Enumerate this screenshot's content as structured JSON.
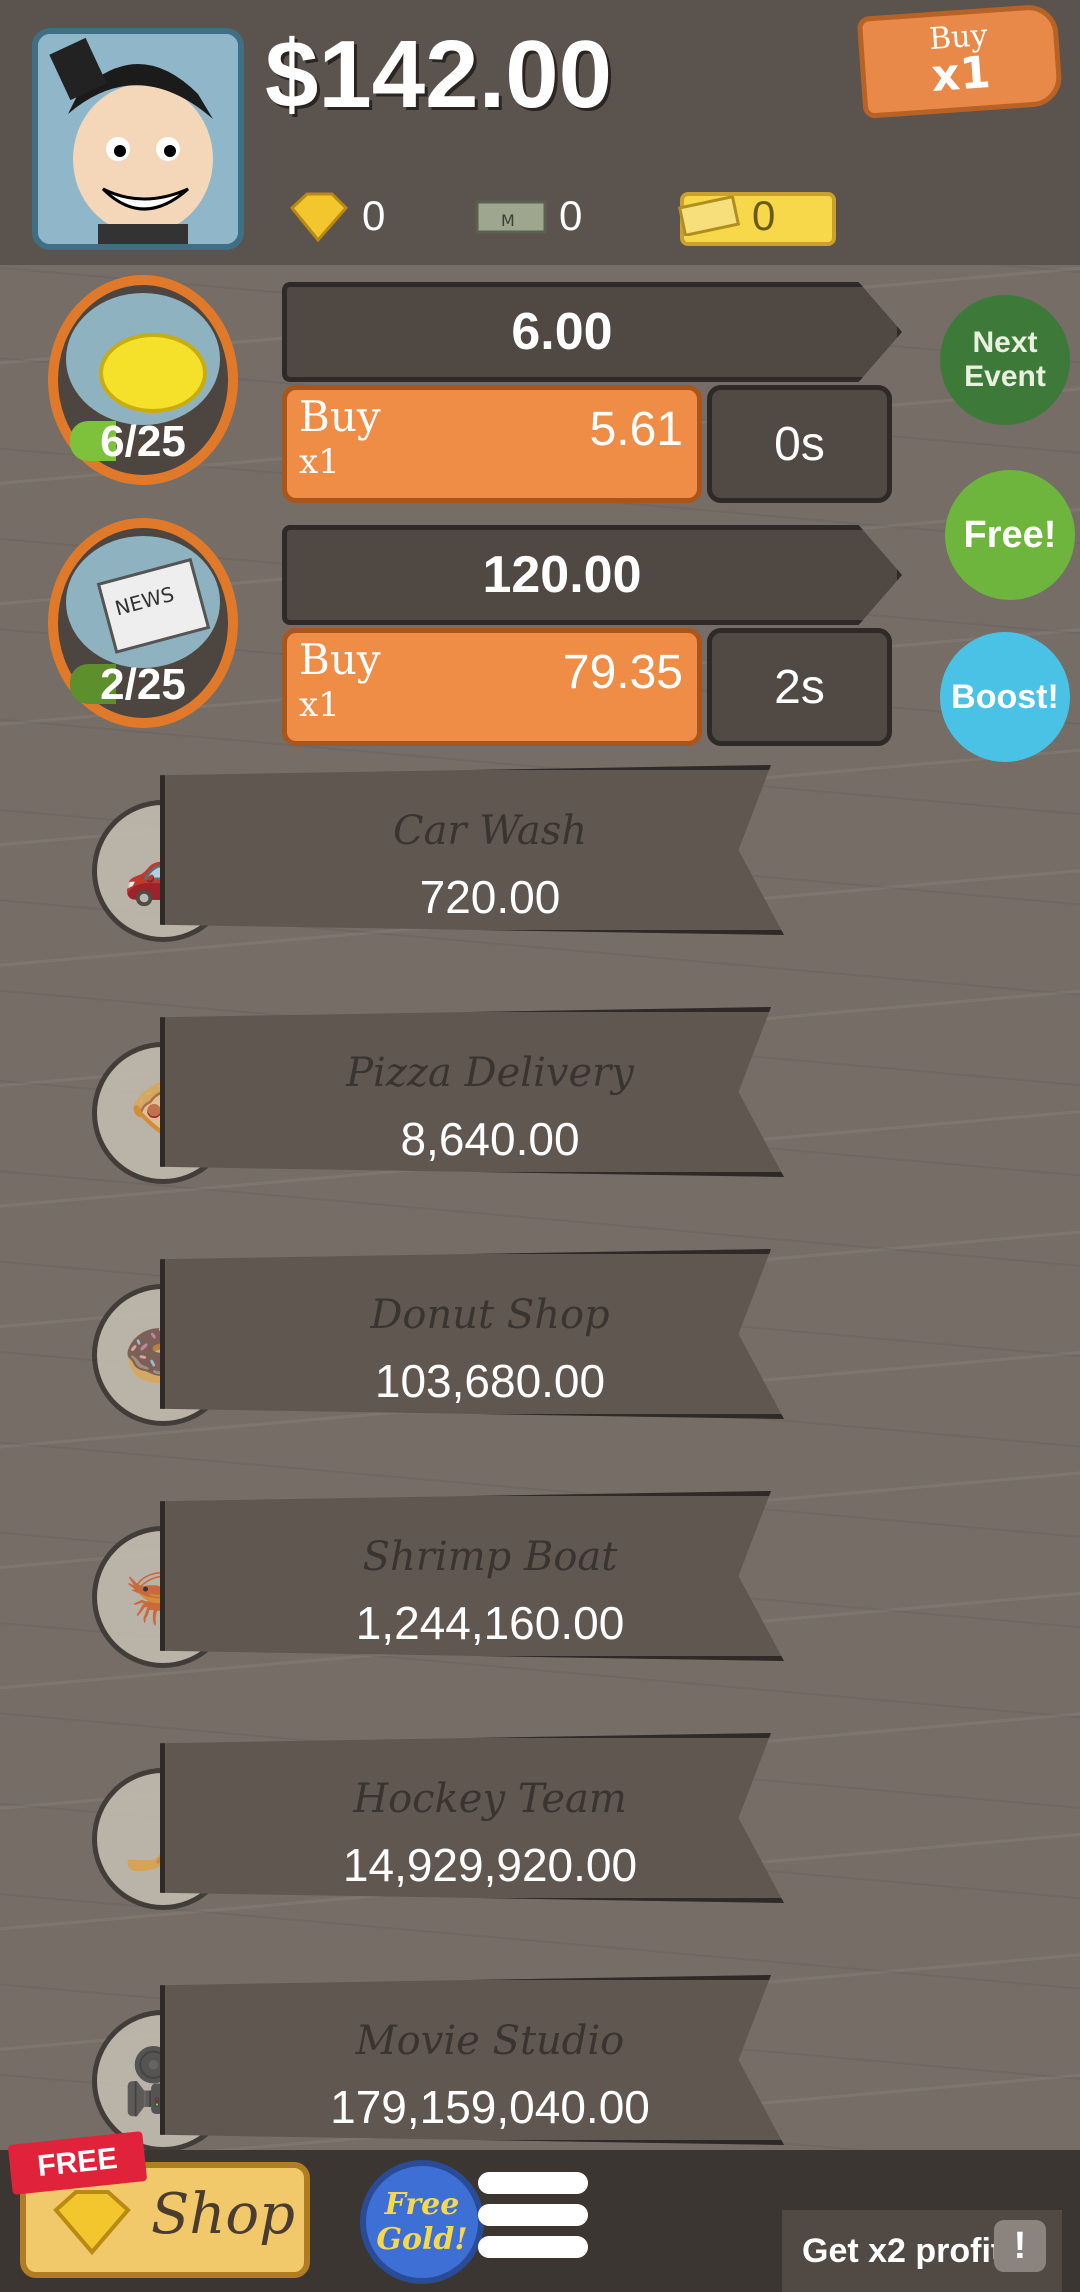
{
  "header": {
    "money": "$142.00",
    "buy_tag": {
      "line1": "Buy",
      "line2": "x1"
    },
    "gold": "0",
    "megabucks": "0",
    "tickets": "0"
  },
  "owned": [
    {
      "id": "lemon",
      "count": "6/25",
      "revenue": "6.00",
      "buy_label": "Buy",
      "buy_qty": "x1",
      "price": "5.61",
      "timer": "0s"
    },
    {
      "id": "news",
      "count": "2/25",
      "revenue": "120.00",
      "buy_label": "Buy",
      "buy_qty": "x1",
      "price": "79.35",
      "timer": "2s"
    }
  ],
  "side": {
    "next_event": "Next Event",
    "free": "Free!",
    "boost": "Boost!"
  },
  "locked": [
    {
      "name": "Car Wash",
      "cost": "720.00"
    },
    {
      "name": "Pizza Delivery",
      "cost": "8,640.00"
    },
    {
      "name": "Donut Shop",
      "cost": "103,680.00"
    },
    {
      "name": "Shrimp Boat",
      "cost": "1,244,160.00"
    },
    {
      "name": "Hockey Team",
      "cost": "14,929,920.00"
    },
    {
      "name": "Movie Studio",
      "cost": "179,159,040.00"
    }
  ],
  "bottom": {
    "free_tag": "FREE",
    "shop": "Shop",
    "free_gold": "Free Gold!",
    "x2_profit": "Get x2 profit!"
  }
}
